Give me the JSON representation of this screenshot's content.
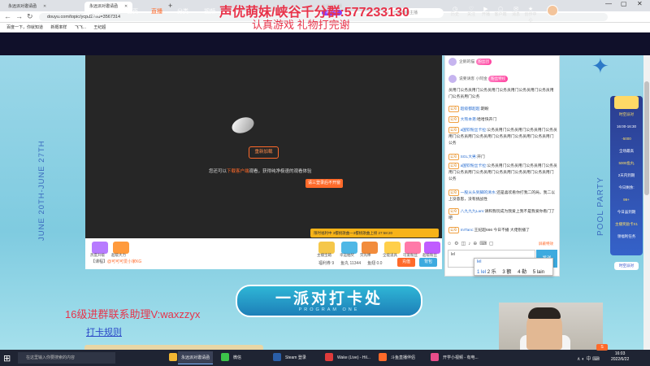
{
  "browser": {
    "tabs": [
      {
        "label": "永远派对邀请函",
        "active": false
      },
      {
        "label": "永远派对邀请函",
        "active": true
      }
    ],
    "new_tab": "+",
    "url": "douyu.com/topic/ycpd2?rid=3567314",
    "bookmarks": [
      "百度一下，你就知道",
      "新概率样",
      "飞飞...",
      "王纪超"
    ]
  },
  "overlay": {
    "title": "声优萌妹/峡谷千分群:577233130",
    "subtitle": "认真游戏  礼物打完谢"
  },
  "site": {
    "logo": "斗鱼",
    "nav": [
      {
        "label": "首页",
        "active": false
      },
      {
        "label": "直播",
        "active": true
      },
      {
        "label": "分类",
        "active": false
      },
      {
        "label": "视频",
        "active": false
      },
      {
        "label": "游戏",
        "active": false
      },
      {
        "label": "鱼吧",
        "active": false
      },
      {
        "label": "星城崛起",
        "active": false
      }
    ],
    "nav_badge_top": "会巡官主播",
    "nav_badge_bottom": "进行中",
    "search_placeholder": "已送出新主播",
    "top_icons": [
      {
        "icon": "◷",
        "label": "历史"
      },
      {
        "icon": "♡",
        "label": "关注"
      },
      {
        "icon": "▶",
        "label": "开播"
      },
      {
        "icon": "☖",
        "label": "客户端"
      },
      {
        "icon": "✉",
        "label": "消息"
      },
      {
        "icon": "★",
        "label": "创作中心"
      }
    ]
  },
  "page": {
    "date_vertical": "JUNE 20TH-JUNE 27TH",
    "pool_party": "POOL PARTY"
  },
  "player": {
    "refresh_button": "重新加载",
    "message_prefix": "您还可以",
    "message_highlight": "下载客户端",
    "message_suffix": "观看，获得纯净极速的观看体验",
    "open_client_button": "请三登录后不开窗",
    "notice": "限时福利中   3樱桃歌曲一3樱桃歌曲上榜 27:58:20"
  },
  "giftbar": {
    "gifts": [
      {
        "label": "热度升级",
        "color": "#b77bff"
      },
      {
        "label": "超级大力",
        "color": "#ff9a3c"
      },
      {
        "label": "主播宝箱",
        "color": "#f5c74a"
      },
      {
        "label": "幸运抽奖",
        "color": "#4fb8e6"
      },
      {
        "label": "荧光棒",
        "color": "#f28c3c"
      },
      {
        "label": "全能道具",
        "color": "#ffcf4a"
      },
      {
        "label": "可爱粉丝",
        "color": "#ff7aa8"
      },
      {
        "label": "超级粉丝",
        "color": "#c05cff"
      }
    ],
    "fans_prefix": "【课程】",
    "fans_highlight": "@可可可爱小家KG",
    "stats": [
      "福利券 9",
      "鱼丸 11344",
      "鱼翅 0.0"
    ],
    "recharge": "充值",
    "bag": "背包"
  },
  "chat": {
    "header_rows": [
      {
        "name": "企鹅的猫",
        "tag": "粉丝团"
      },
      {
        "name": "说要请客 小阿金",
        "tag": "粉丝特权"
      }
    ],
    "rows": [
      {
        "badge": "",
        "name": "",
        "text": "员用门公务员用门公务员用门公务员用门公务员用门公务员用门公务员用门公务"
      },
      {
        "badge": "公众",
        "name": "超级都超超:",
        "text": "期盼"
      },
      {
        "badge": "公众",
        "name": "大熊本弟:",
        "text": "哈哈快开门"
      },
      {
        "badge": "公众",
        "name": "a国钦粉丝卡拉:",
        "text": "公务员用门公务员用门公务员用门公务员用门公务员用门公务员用门公务员用门公务员用门公务员用门公务"
      },
      {
        "badge": "公众",
        "name": "SGL大男:",
        "text": "开门"
      },
      {
        "badge": "公众",
        "name": "a国钦粉丝卡拉:",
        "text": "公务员用门公务员用门公务员用门公务员用门公务员用门公务员用门公务员用门公务员用门公务员用门公务"
      },
      {
        "badge": "公众",
        "name": "一股从头到脚的清水:",
        "text": "还是喜欢看你打我二的局，我二以上没意思，没有挑战性"
      },
      {
        "badge": "公众",
        "name": "八九九九Lam:",
        "text": "请和我玩成为我爱上我不是我爱你看门了吧"
      },
      {
        "badge": "公众",
        "name": "mrTanc:",
        "text": "王纪超666 今日不播 大佬别播了"
      }
    ],
    "input_text": "lel",
    "send_button": "发送",
    "tools": [
      "☺",
      "⚙",
      "◫",
      "♪",
      "⊕",
      "⌨",
      "▢"
    ],
    "tools_right": "屏蔽特效"
  },
  "ime": {
    "pinyin": "lel",
    "candidates": [
      "1 lel",
      "2 乐",
      "3 额",
      "4 勒",
      "5 lain"
    ]
  },
  "right_panel": {
    "items": [
      {
        "text": "时空派对",
        "yellow": true
      },
      {
        "text": "16:00-16:30",
        "yellow": false
      },
      {
        "text": "-5000",
        "yellow": true
      },
      {
        "text": "全场最高",
        "yellow": false
      },
      {
        "text": "5000鱼丸",
        "yellow": true
      },
      {
        "text": "2天内到期",
        "yellow": false
      },
      {
        "text": "今日剩余:",
        "yellow": false
      },
      {
        "text": "99+",
        "yellow": true
      },
      {
        "text": "今日虽到期",
        "yellow": false
      },
      {
        "text": "主播奖励卡X1",
        "yellow": true
      },
      {
        "text": "领福利任务",
        "yellow": false
      }
    ],
    "footer": "时空派对"
  },
  "banner": {
    "title": "一派对打卡处",
    "subtitle": "PROGRAM ONE"
  },
  "stream_overlay": {
    "group": "16级进群联系助理V:waxzzyx",
    "rules": "打卡规则"
  },
  "taskbar": {
    "search": "在这里输入你要搜索的内容",
    "items": [
      {
        "label": "永远派对邀请函",
        "color": "#f2b632",
        "active": true
      },
      {
        "label": "微信",
        "color": "#3cc34a",
        "active": false
      },
      {
        "label": "Steam 登录",
        "color": "#2a5ea8",
        "active": false
      },
      {
        "label": "Wake (Live) - Hil...",
        "color": "#e03b3b",
        "active": false
      },
      {
        "label": "斗鱼直播伴侣",
        "color": "#ff6a2a",
        "active": false
      },
      {
        "label": "开学小视频 - 有电...",
        "color": "#e84d8a",
        "active": false
      }
    ],
    "tray": "∧  ◐  中  ⌨",
    "time": "16:03",
    "date": "2022/6/22"
  },
  "colors": {
    "accent": "#ff6a2a",
    "overlay_red": "#e8334a",
    "nav_bg": "#10102a"
  }
}
